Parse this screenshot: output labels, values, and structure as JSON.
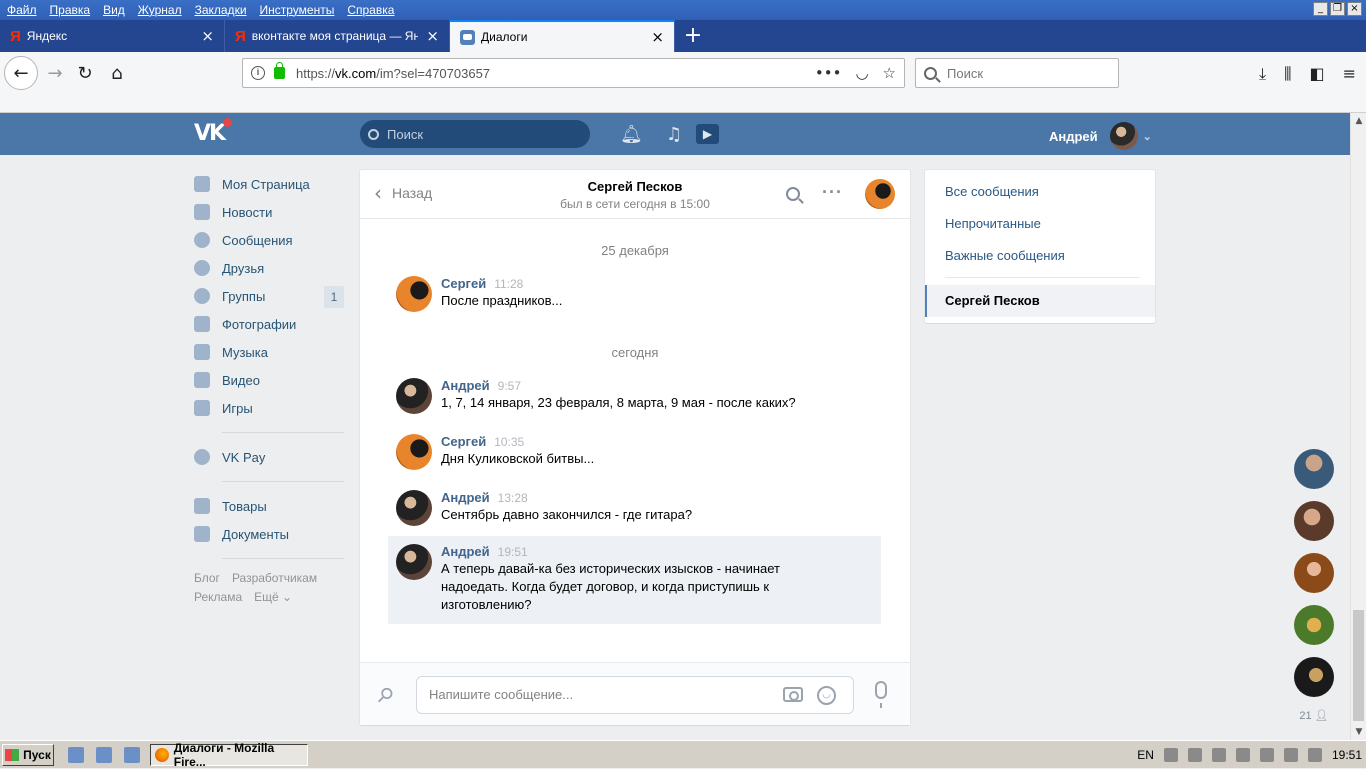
{
  "browser": {
    "menu": [
      "Файл",
      "Правка",
      "Вид",
      "Журнал",
      "Закладки",
      "Инструменты",
      "Справка"
    ],
    "tabs": [
      {
        "title": "Яндекс"
      },
      {
        "title": "вконтакте моя страница — Янде"
      },
      {
        "title": "Диалоги"
      }
    ],
    "url_prefix": "https://",
    "url_domain": "vk.com",
    "url_path": "/im?sel=470703657",
    "search_placeholder": "Поиск"
  },
  "vk_header": {
    "logo": "VK",
    "search_placeholder": "Поиск",
    "user_name": "Андрей"
  },
  "sidebar": {
    "items": [
      {
        "label": "Моя Страница"
      },
      {
        "label": "Новости"
      },
      {
        "label": "Сообщения"
      },
      {
        "label": "Друзья"
      },
      {
        "label": "Группы",
        "badge": "1"
      },
      {
        "label": "Фотографии"
      },
      {
        "label": "Музыка"
      },
      {
        "label": "Видео"
      },
      {
        "label": "Игры"
      },
      {
        "label": "VK Pay"
      },
      {
        "label": "Товары"
      },
      {
        "label": "Документы"
      }
    ],
    "footer": [
      "Блог",
      "Разработчикам",
      "Реклама",
      "Ещё ⌄"
    ]
  },
  "chat": {
    "back_label": "Назад",
    "name": "Сергей Песков",
    "status": "был в сети сегодня в 15:00",
    "dates": [
      "25 декабря",
      "сегодня"
    ],
    "messages": [
      {
        "author": "Сергей",
        "time": "11:28",
        "text": "После праздников..."
      },
      {
        "author": "Андрей",
        "time": "9:57",
        "text": "1, 7, 14 января, 23 февраля, 8 марта, 9 мая - после каких?"
      },
      {
        "author": "Сергей",
        "time": "10:35",
        "text": "Дня Куликовской битвы..."
      },
      {
        "author": "Андрей",
        "time": "13:28",
        "text": "Сентябрь давно закончился - где гитара?"
      },
      {
        "author": "Андрей",
        "time": "19:51",
        "text": "А теперь давай-ка без исторических изысков - начинает надоедать. Когда будет договор, и когда приступишь к изготовлению?"
      }
    ],
    "composer_placeholder": "Напишите сообщение..."
  },
  "right_panel": {
    "links": [
      "Все сообщения",
      "Непрочитанные",
      "Важные сообщения"
    ],
    "selected": "Сергей Песков"
  },
  "friends_online": {
    "count": "21"
  },
  "taskbar": {
    "start": "Пуск",
    "window": "Диалоги - Mozilla Fire...",
    "lang": "EN",
    "clock": "19:51"
  }
}
